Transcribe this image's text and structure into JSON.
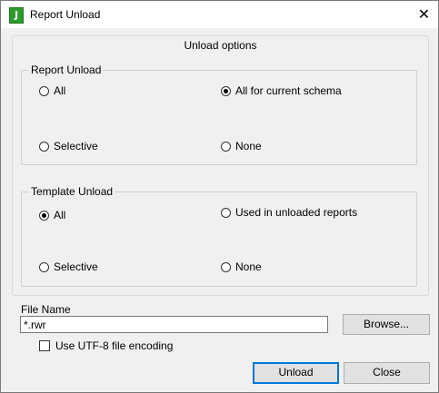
{
  "window": {
    "title": "Report Unload",
    "app_icon_glyph": "J",
    "close_glyph": "✕"
  },
  "options": {
    "title": "Unload options",
    "report_unload": {
      "legend": "Report Unload",
      "options": [
        {
          "label": "All",
          "checked": false
        },
        {
          "label": "All for current schema",
          "checked": true
        },
        {
          "label": "Selective",
          "checked": false
        },
        {
          "label": "None",
          "checked": false
        }
      ]
    },
    "template_unload": {
      "legend": "Template Unload",
      "options": [
        {
          "label": "All",
          "checked": true
        },
        {
          "label": "Used in unloaded reports",
          "checked": false
        },
        {
          "label": "Selective",
          "checked": false
        },
        {
          "label": "None",
          "checked": false
        }
      ]
    }
  },
  "file": {
    "label": "File Name",
    "value": "*.rwr",
    "browse_label": "Browse...",
    "utf8_label": "Use UTF-8 file encoding",
    "utf8_checked": false
  },
  "actions": {
    "unload_label": "Unload",
    "close_label": "Close"
  },
  "colors": {
    "app_icon": "#2e9a2e",
    "default_button_border": "#0078d7"
  }
}
